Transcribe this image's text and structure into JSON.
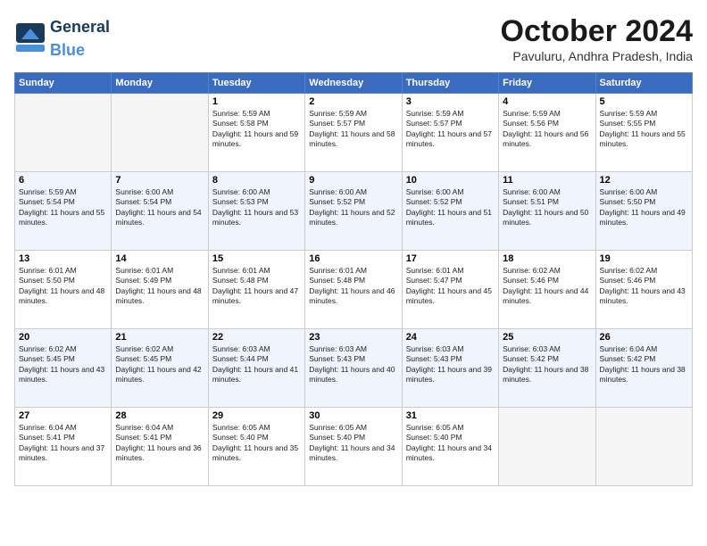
{
  "logo": {
    "general": "General",
    "blue": "Blue"
  },
  "title": "October 2024",
  "location": "Pavuluru, Andhra Pradesh, India",
  "headers": [
    "Sunday",
    "Monday",
    "Tuesday",
    "Wednesday",
    "Thursday",
    "Friday",
    "Saturday"
  ],
  "weeks": [
    [
      {
        "day": "",
        "info": ""
      },
      {
        "day": "",
        "info": ""
      },
      {
        "day": "1",
        "info": "Sunrise: 5:59 AM\nSunset: 5:58 PM\nDaylight: 11 hours and 59 minutes."
      },
      {
        "day": "2",
        "info": "Sunrise: 5:59 AM\nSunset: 5:57 PM\nDaylight: 11 hours and 58 minutes."
      },
      {
        "day": "3",
        "info": "Sunrise: 5:59 AM\nSunset: 5:57 PM\nDaylight: 11 hours and 57 minutes."
      },
      {
        "day": "4",
        "info": "Sunrise: 5:59 AM\nSunset: 5:56 PM\nDaylight: 11 hours and 56 minutes."
      },
      {
        "day": "5",
        "info": "Sunrise: 5:59 AM\nSunset: 5:55 PM\nDaylight: 11 hours and 55 minutes."
      }
    ],
    [
      {
        "day": "6",
        "info": "Sunrise: 5:59 AM\nSunset: 5:54 PM\nDaylight: 11 hours and 55 minutes."
      },
      {
        "day": "7",
        "info": "Sunrise: 6:00 AM\nSunset: 5:54 PM\nDaylight: 11 hours and 54 minutes."
      },
      {
        "day": "8",
        "info": "Sunrise: 6:00 AM\nSunset: 5:53 PM\nDaylight: 11 hours and 53 minutes."
      },
      {
        "day": "9",
        "info": "Sunrise: 6:00 AM\nSunset: 5:52 PM\nDaylight: 11 hours and 52 minutes."
      },
      {
        "day": "10",
        "info": "Sunrise: 6:00 AM\nSunset: 5:52 PM\nDaylight: 11 hours and 51 minutes."
      },
      {
        "day": "11",
        "info": "Sunrise: 6:00 AM\nSunset: 5:51 PM\nDaylight: 11 hours and 50 minutes."
      },
      {
        "day": "12",
        "info": "Sunrise: 6:00 AM\nSunset: 5:50 PM\nDaylight: 11 hours and 49 minutes."
      }
    ],
    [
      {
        "day": "13",
        "info": "Sunrise: 6:01 AM\nSunset: 5:50 PM\nDaylight: 11 hours and 48 minutes."
      },
      {
        "day": "14",
        "info": "Sunrise: 6:01 AM\nSunset: 5:49 PM\nDaylight: 11 hours and 48 minutes."
      },
      {
        "day": "15",
        "info": "Sunrise: 6:01 AM\nSunset: 5:48 PM\nDaylight: 11 hours and 47 minutes."
      },
      {
        "day": "16",
        "info": "Sunrise: 6:01 AM\nSunset: 5:48 PM\nDaylight: 11 hours and 46 minutes."
      },
      {
        "day": "17",
        "info": "Sunrise: 6:01 AM\nSunset: 5:47 PM\nDaylight: 11 hours and 45 minutes."
      },
      {
        "day": "18",
        "info": "Sunrise: 6:02 AM\nSunset: 5:46 PM\nDaylight: 11 hours and 44 minutes."
      },
      {
        "day": "19",
        "info": "Sunrise: 6:02 AM\nSunset: 5:46 PM\nDaylight: 11 hours and 43 minutes."
      }
    ],
    [
      {
        "day": "20",
        "info": "Sunrise: 6:02 AM\nSunset: 5:45 PM\nDaylight: 11 hours and 43 minutes."
      },
      {
        "day": "21",
        "info": "Sunrise: 6:02 AM\nSunset: 5:45 PM\nDaylight: 11 hours and 42 minutes."
      },
      {
        "day": "22",
        "info": "Sunrise: 6:03 AM\nSunset: 5:44 PM\nDaylight: 11 hours and 41 minutes."
      },
      {
        "day": "23",
        "info": "Sunrise: 6:03 AM\nSunset: 5:43 PM\nDaylight: 11 hours and 40 minutes."
      },
      {
        "day": "24",
        "info": "Sunrise: 6:03 AM\nSunset: 5:43 PM\nDaylight: 11 hours and 39 minutes."
      },
      {
        "day": "25",
        "info": "Sunrise: 6:03 AM\nSunset: 5:42 PM\nDaylight: 11 hours and 38 minutes."
      },
      {
        "day": "26",
        "info": "Sunrise: 6:04 AM\nSunset: 5:42 PM\nDaylight: 11 hours and 38 minutes."
      }
    ],
    [
      {
        "day": "27",
        "info": "Sunrise: 6:04 AM\nSunset: 5:41 PM\nDaylight: 11 hours and 37 minutes."
      },
      {
        "day": "28",
        "info": "Sunrise: 6:04 AM\nSunset: 5:41 PM\nDaylight: 11 hours and 36 minutes."
      },
      {
        "day": "29",
        "info": "Sunrise: 6:05 AM\nSunset: 5:40 PM\nDaylight: 11 hours and 35 minutes."
      },
      {
        "day": "30",
        "info": "Sunrise: 6:05 AM\nSunset: 5:40 PM\nDaylight: 11 hours and 34 minutes."
      },
      {
        "day": "31",
        "info": "Sunrise: 6:05 AM\nSunset: 5:40 PM\nDaylight: 11 hours and 34 minutes."
      },
      {
        "day": "",
        "info": ""
      },
      {
        "day": "",
        "info": ""
      }
    ]
  ]
}
